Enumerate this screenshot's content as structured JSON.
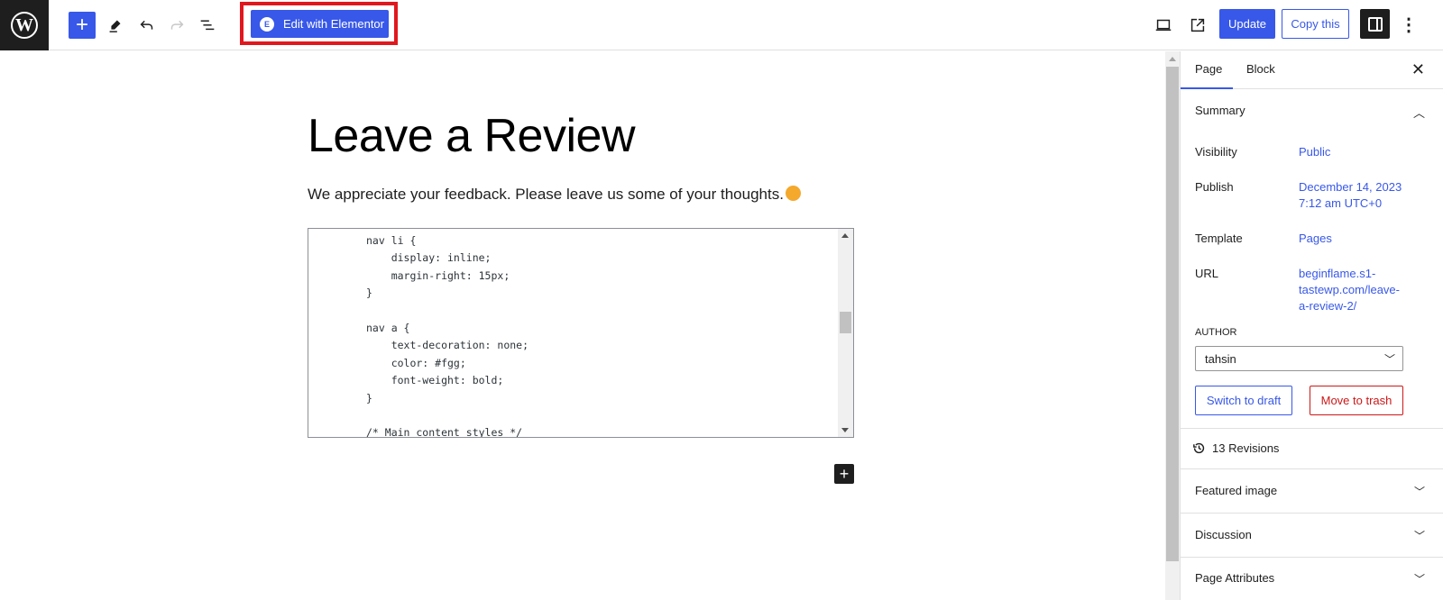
{
  "toolbar": {
    "logo": "W",
    "add_block": "+",
    "edit_with_elementor": "Edit with Elementor",
    "elementor_glyph": "E",
    "update": "Update",
    "copy_this": "Copy this",
    "more": "⋮"
  },
  "canvas": {
    "title": "Leave a Review",
    "paragraph": "We appreciate your feedback. Please leave us some of your thoughts.",
    "code_lines": [
      "nav li {",
      "    display: inline;",
      "    margin-right: 15px;",
      "}",
      "",
      "nav a {",
      "    text-decoration: none;",
      "    color: #fgg;",
      "    font-weight: bold;",
      "}",
      "",
      "/* Main content styles */"
    ],
    "inserter": "+"
  },
  "sidebar": {
    "tabs": [
      {
        "label": "Page",
        "active": true
      },
      {
        "label": "Block",
        "active": false
      }
    ],
    "close": "✕",
    "summary": {
      "heading": "Summary",
      "rows": [
        {
          "label": "Visibility",
          "value": "Public"
        },
        {
          "label": "Publish",
          "value": "December 14, 2023 7:12 am UTC+0"
        },
        {
          "label": "Template",
          "value": "Pages"
        },
        {
          "label": "URL",
          "value": "beginflame.s1-tastewp.com/leave-a-review-2/"
        }
      ],
      "author_label": "Author",
      "author_value": "tahsin",
      "switch_to_draft": "Switch to draft",
      "move_to_trash": "Move to trash"
    },
    "revisions": "13 Revisions",
    "panels": [
      {
        "label": "Featured image"
      },
      {
        "label": "Discussion"
      },
      {
        "label": "Page Attributes"
      }
    ]
  },
  "colors": {
    "accent": "#3858e9",
    "danger": "#cc1818",
    "highlight_outline": "#e1171e"
  }
}
